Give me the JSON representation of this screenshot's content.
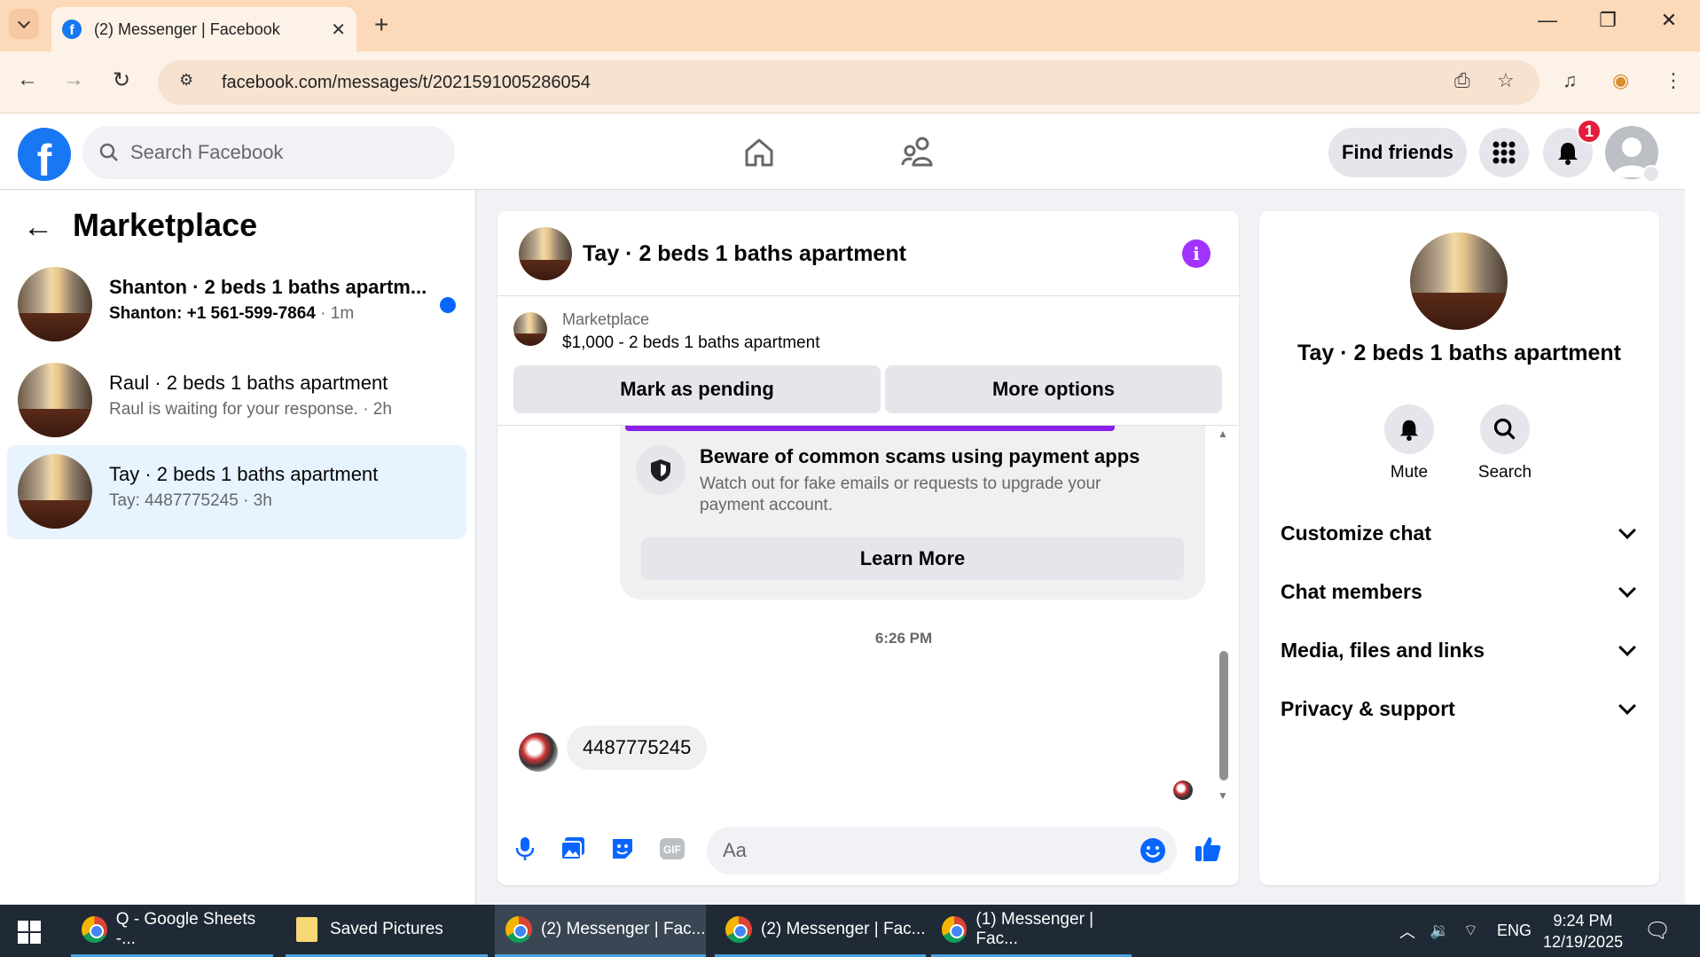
{
  "browser": {
    "tab_title": "(2) Messenger | Facebook",
    "tab_favicon": "facebook-icon",
    "url": "facebook.com/messages/t/2021591005286054"
  },
  "fb": {
    "search_placeholder": "Search Facebook",
    "find_friends": "Find friends",
    "notification_count": "1"
  },
  "sidebar": {
    "title": "Marketplace",
    "conversations": [
      {
        "name": "Shanton · 2 beds 1 baths apartm...",
        "preview": "Shanton: +1 561-599-7864",
        "time": " · 1m",
        "unread": true
      },
      {
        "name": "Raul · 2 beds 1 baths apartment",
        "preview": "Raul is waiting for your response.",
        "time": " · 2h",
        "unread": false
      },
      {
        "name": "Tay · 2 beds 1 baths apartment",
        "preview": "Tay: 4487775245",
        "time": " · 3h",
        "unread": false,
        "active": true
      }
    ]
  },
  "chat": {
    "title": "Tay · 2 beds 1 baths apartment",
    "listing_label": "Marketplace",
    "listing_title": "$1,000 - 2 beds 1 baths apartment",
    "mark_pending": "Mark as pending",
    "more_options": "More options",
    "scam_title": "Beware of common scams using payment apps",
    "scam_body": "Watch out for fake emails or requests to upgrade your payment account.",
    "learn_more": "Learn More",
    "timestamp": "6:26 PM",
    "message": "4487775245",
    "input_placeholder": "Aa"
  },
  "rpanel": {
    "title": "Tay · 2 beds 1 baths apartment",
    "mute": "Mute",
    "search": "Search",
    "sections": [
      "Customize chat",
      "Chat members",
      "Media, files and links",
      "Privacy & support"
    ]
  },
  "taskbar": {
    "apps": [
      "Q - Google Sheets -...",
      "Saved Pictures",
      "(2) Messenger | Fac...",
      "(2) Messenger | Fac...",
      "(1) Messenger | Fac..."
    ],
    "lang": "ENG",
    "time": "9:24 PM",
    "date": "12/19/2025"
  },
  "colors": {
    "fb_blue": "#1877f2",
    "unread_dot": "#0866ff",
    "info_purple": "#a033ff",
    "active_conv": "#e7f3ff"
  }
}
